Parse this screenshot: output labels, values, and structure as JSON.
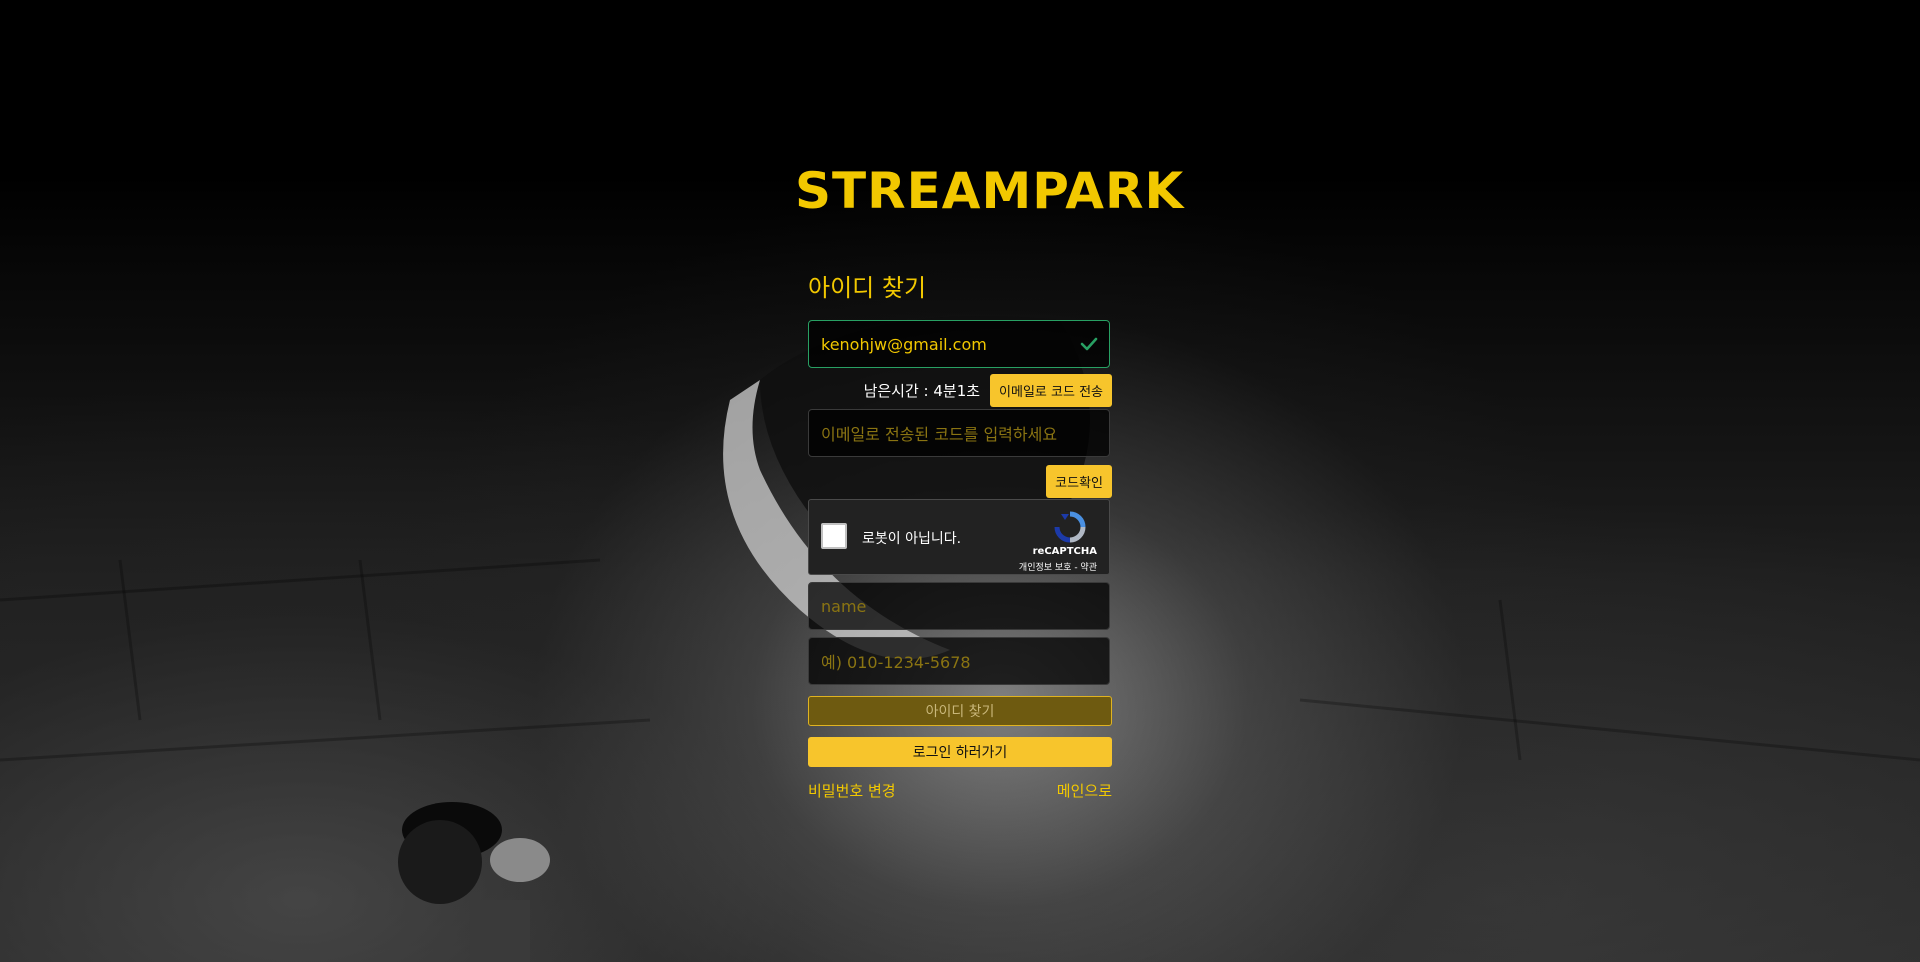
{
  "brand": {
    "logo_text": "STREAMPARK",
    "accent_color": "#f2c800",
    "button_color": "#f7c52c",
    "success_color": "#28a063"
  },
  "form": {
    "title": "아이디 찾기",
    "email_value": "kenohjw@gmail.com",
    "email_status_icon": "check-icon",
    "timer_label": "남은시간 : 4분1초",
    "send_code_button": "이메일로 코드 전송",
    "code_placeholder": "이메일로 전송된 코드를 입력하세요",
    "confirm_code_button": "코드확인",
    "name_placeholder": "name",
    "phone_placeholder": "예) 010-1234-5678",
    "find_id_button": "아이디 찾기",
    "go_login_button": "로그인 하러가기"
  },
  "recaptcha": {
    "label": "로봇이 아닙니다.",
    "brand": "reCAPTCHA",
    "links": "개인정보 보호 - 약관"
  },
  "footer_links": {
    "change_password": "비밀번호 변경",
    "to_main": "메인으로"
  }
}
